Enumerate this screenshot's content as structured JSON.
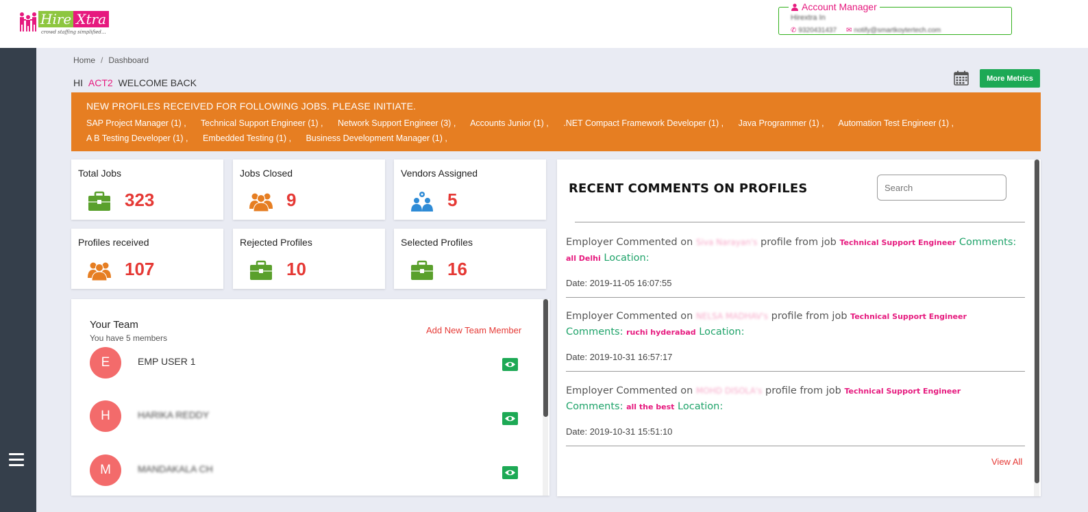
{
  "header": {
    "logo": {
      "hire": "Hire",
      "xtra": "Xtra",
      "tagline": "crowd staffing simplified..."
    },
    "account_manager": {
      "title": "Account Manager",
      "name": "Hirextra In",
      "phone": "9320431437",
      "email": "notify@smartkoytertech.com"
    }
  },
  "breadcrumb": {
    "home": "Home",
    "separator": "/",
    "current": "Dashboard"
  },
  "welcome": {
    "prefix": "HI",
    "user": "ACT2",
    "suffix": "WELCOME BACK"
  },
  "toolbar": {
    "more_metrics": "More Metrics",
    "calendar_icon": "calendar-icon"
  },
  "banner": {
    "title": "NEW PROFILES RECEIVED FOR FOLLOWING JOBS. PLEASE INITIATE.",
    "jobs": [
      "SAP Project Manager (1) ,",
      "Technical Support Engineer (1) ,",
      "Network Support Engineer (3) ,",
      "Accounts Junior (1) ,",
      ".NET Compact Framework Developer (1) ,",
      "Java Programmer (1) ,",
      "Automation Test Engineer (1) ,",
      "A B Testing Developer (1) ,",
      "Embedded Testing (1) ,",
      "Business Development Manager (1) ,"
    ]
  },
  "stats": [
    {
      "label": "Total Jobs",
      "value": "323",
      "icon": "briefcase-icon",
      "color": "#5aa02c"
    },
    {
      "label": "Jobs Closed",
      "value": "9",
      "icon": "group-icon",
      "color": "#e67e22"
    },
    {
      "label": "Vendors Assigned",
      "value": "5",
      "icon": "vendors-icon",
      "color": "#2e8bd6"
    },
    {
      "label": "Profiles received",
      "value": "107",
      "icon": "group-icon",
      "color": "#e67e22"
    },
    {
      "label": "Rejected Profiles",
      "value": "10",
      "icon": "briefcase-icon",
      "color": "#5aa02c"
    },
    {
      "label": "Selected Profiles",
      "value": "16",
      "icon": "briefcase-icon",
      "color": "#5aa02c"
    }
  ],
  "team": {
    "title": "Your Team",
    "subtitle": "You have 5 members",
    "add_label": "Add New Team Member",
    "members": [
      {
        "initial": "E",
        "name": "EMP USER 1"
      },
      {
        "initial": "H",
        "name": "HARIKA REDDY"
      },
      {
        "initial": "M",
        "name": "MANDAKALA CH"
      }
    ]
  },
  "comments": {
    "heading": "RECENT COMMENTS ON PROFILES",
    "search_placeholder": "Search",
    "prefix": "Employer Commented on",
    "from_job": "profile from job",
    "comments_label": "Comments:",
    "location_label": "Location:",
    "date_label": "Date:",
    "view_all": "View All",
    "items": [
      {
        "profile": "Siva Narayan's",
        "job": "Technical Support Engineer",
        "comment": "all Delhi",
        "date": "2019-11-05 16:07:55"
      },
      {
        "profile": "NELSA MADHAV's",
        "job": "Technical Support Engineer",
        "comment": "ruchi hyderabad",
        "date": "2019-10-31 16:57:17"
      },
      {
        "profile": "MOHD DISOLA's",
        "job": "Technical Support Engineer",
        "comment": "all the best",
        "date": "2019-10-31 15:51:10"
      }
    ]
  }
}
